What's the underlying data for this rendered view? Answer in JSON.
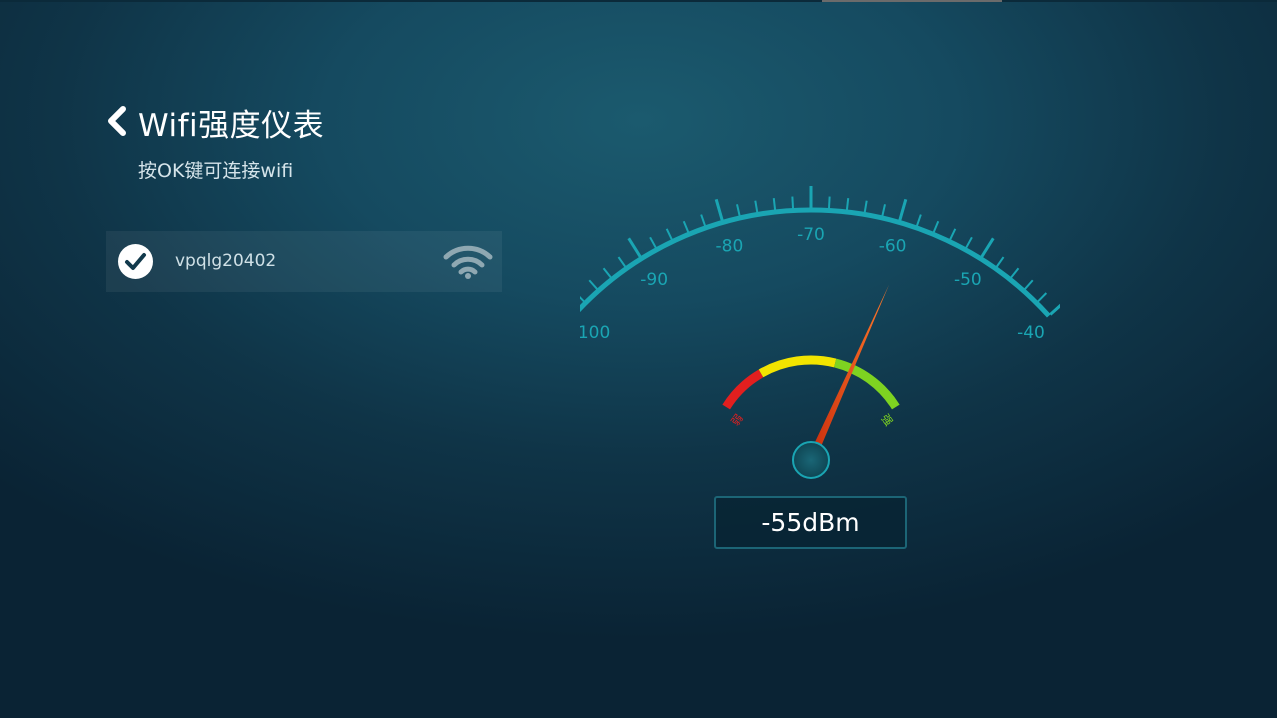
{
  "header": {
    "title": "Wifi强度仪表",
    "subtitle": "按OK键可连接wifi"
  },
  "wifi_list": [
    {
      "ssid": "vpqlg20402",
      "connected": true,
      "signal_icon": "wifi-signal-icon"
    }
  ],
  "gauge": {
    "unit_label": "dBm",
    "scale_min": -100,
    "scale_max": -40,
    "tick_labels": [
      "-100",
      "-90",
      "-80",
      "-70",
      "-60",
      "-50",
      "-40"
    ],
    "value_dbm": -55,
    "readout": "-55dBm",
    "band_low_label": "弱",
    "band_high_label": "强",
    "colors": {
      "scale": "#1aa5b3",
      "low": "#e21f1f",
      "mid": "#f2e400",
      "high": "#7ed321",
      "needle": "#ff5a1f"
    }
  }
}
